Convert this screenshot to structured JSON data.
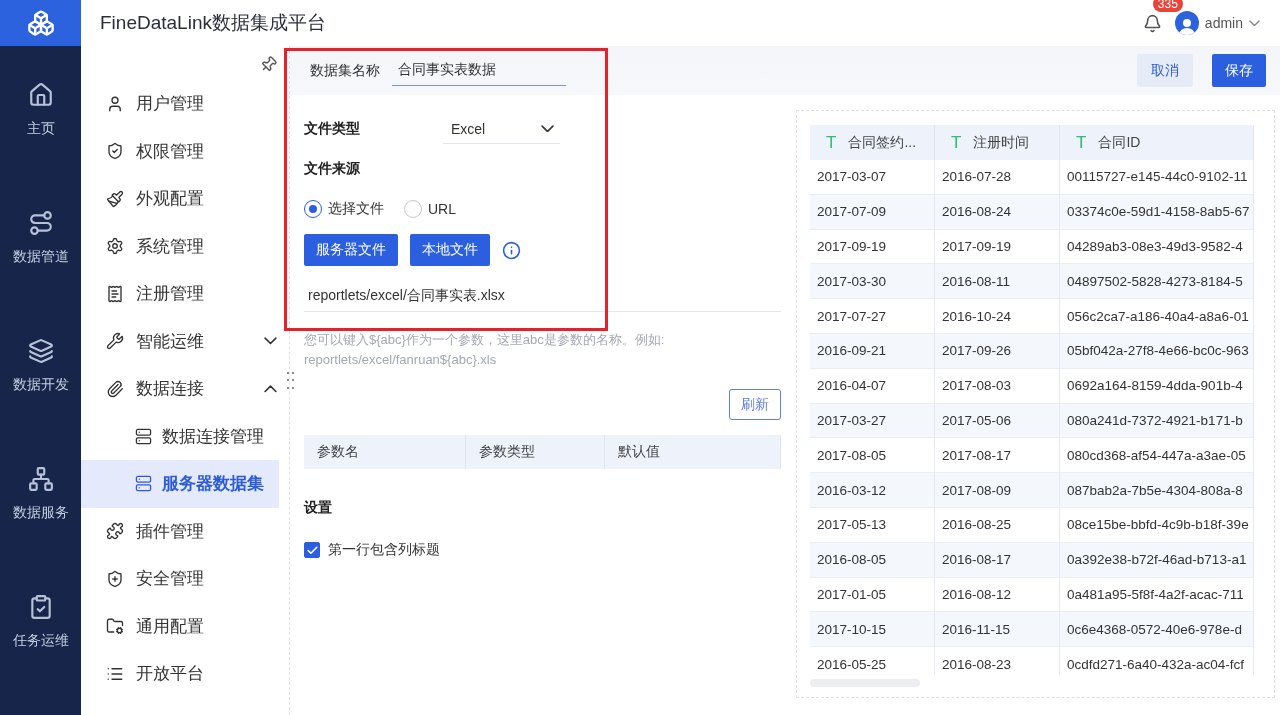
{
  "app": {
    "title": "FineDataLink数据集成平台"
  },
  "header": {
    "notification_count": "335",
    "user": "admin"
  },
  "rail": [
    {
      "label": "主页"
    },
    {
      "label": "数据管道"
    },
    {
      "label": "数据开发"
    },
    {
      "label": "数据服务"
    },
    {
      "label": "任务运维"
    }
  ],
  "sidebar": {
    "items": [
      {
        "label": "用户管理",
        "selected": false
      },
      {
        "label": "权限管理",
        "selected": false
      },
      {
        "label": "外观配置",
        "selected": false
      },
      {
        "label": "系统管理",
        "selected": false
      },
      {
        "label": "注册管理",
        "selected": false
      },
      {
        "label": "智能运维",
        "selected": false,
        "expanded": false
      },
      {
        "label": "数据连接",
        "selected": false,
        "expanded": true,
        "children": [
          {
            "label": "数据连接管理",
            "selected": false
          },
          {
            "label": "服务器数据集",
            "selected": true
          }
        ]
      },
      {
        "label": "插件管理",
        "selected": false
      },
      {
        "label": "安全管理",
        "selected": false
      },
      {
        "label": "通用配置",
        "selected": false
      },
      {
        "label": "开放平台",
        "selected": false
      }
    ]
  },
  "form": {
    "name_label": "数据集名称",
    "name_value": "合同事实表数据",
    "file_type_label": "文件类型",
    "file_type_value": "Excel",
    "source_label": "文件来源",
    "source_options": [
      {
        "label": "选择文件",
        "selected": true
      },
      {
        "label": "URL",
        "selected": false
      }
    ],
    "file_buttons": [
      "服务器文件",
      "本地文件"
    ],
    "path": "reportlets/excel/合同事实表.xlsx",
    "hint": "您可以键入${abc}作为一个参数，这里abc是参数的名称。例如: reportlets/excel/fanruan${abc}.xls",
    "refresh": "刷新",
    "param_columns": [
      "参数名",
      "参数类型",
      "默认值"
    ],
    "settings_title": "设置",
    "header_checkbox": {
      "label": "第一行包含列标题",
      "checked": true
    }
  },
  "actions": {
    "cancel": "取消",
    "save": "保存"
  },
  "preview": {
    "columns": [
      {
        "type": "T",
        "label": "合同签约..."
      },
      {
        "type": "T",
        "label": "注册时间"
      },
      {
        "type": "T",
        "label": "合同ID"
      }
    ],
    "rows": [
      [
        "2017-03-07",
        "2016-07-28",
        "00115727-e145-44c0-9102-11"
      ],
      [
        "2017-07-09",
        "2016-08-24",
        "03374c0e-59d1-4158-8ab5-67"
      ],
      [
        "2017-09-19",
        "2017-09-19",
        "04289ab3-08e3-49d3-9582-4"
      ],
      [
        "2017-03-30",
        "2016-08-11",
        "04897502-5828-4273-8184-5"
      ],
      [
        "2017-07-27",
        "2016-10-24",
        "056c2ca7-a186-40a4-a8a6-01"
      ],
      [
        "2016-09-21",
        "2017-09-26",
        "05bf042a-27f8-4e66-bc0c-963"
      ],
      [
        "2016-04-07",
        "2017-08-03",
        "0692a164-8159-4dda-901b-4"
      ],
      [
        "2017-03-27",
        "2017-05-06",
        "080a241d-7372-4921-b171-b"
      ],
      [
        "2017-08-05",
        "2017-08-17",
        "080cd368-af54-447a-a3ae-05"
      ],
      [
        "2016-03-12",
        "2017-08-09",
        "087bab2a-7b5e-4304-808a-8"
      ],
      [
        "2017-05-13",
        "2016-08-25",
        "08ce15be-bbfd-4c9b-b18f-39e"
      ],
      [
        "2016-08-05",
        "2016-08-17",
        "0a392e38-b72f-46ad-b713-a1"
      ],
      [
        "2017-01-05",
        "2016-08-12",
        "0a481a95-5f8f-4a2f-acac-711"
      ],
      [
        "2017-10-15",
        "2016-11-15",
        "0c6e4368-0572-40e6-978e-d"
      ],
      [
        "2016-05-25",
        "2016-08-23",
        "0cdfd271-6a40-432a-ac04-fcf"
      ]
    ]
  }
}
